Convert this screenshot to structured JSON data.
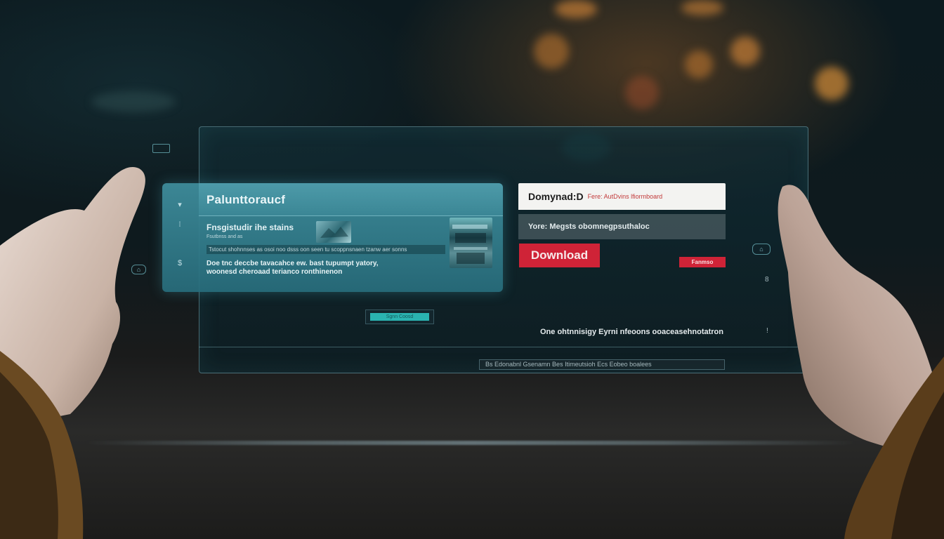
{
  "window": {
    "card_title": "Palunttoraucf",
    "card_subtitle": "Fnsgistudir ihe stains",
    "card_caption": "Fsutbnss and as",
    "card_strip": "Tstocut shohnnses as osoi noo dsss oon seen tu scoppnsnaen tzanw aer sonns",
    "card_description": "Doe tnc deccbe tavacahce ew. bast tupumpt yatory, woonesd cheroaad terianco ronthinenon"
  },
  "rail": {
    "glyph_1": "▾",
    "glyph_2": "⁝",
    "glyph_3": "$"
  },
  "download_panel": {
    "title": "Domynad:D",
    "title_note": "Fere: AutDvins lfiormboard",
    "subtitle": "Yore: Megsts obomnegpsuthaloc",
    "primary_button": "Download",
    "secondary_button": "Fanmso"
  },
  "lower": {
    "center_button": "Sgnn Coosd",
    "footer_text": "One ohtnnisigy Eyrni nfeoons ooaceasehnotatron",
    "status_bar": "Bs Edonabnl Gsenamn Bes Itimeutsioh  Ecs  Eobeo boalees",
    "right_glyph_1": "8",
    "right_glyph_2": "!"
  },
  "outside_widgets": {
    "pill_left": "⌂",
    "pill_right": "⌂"
  },
  "colors": {
    "card_teal": "#3e8c9b",
    "download_red": "#cf2337",
    "panel_white": "#f3f3f1",
    "accent_cyan": "#2ab3b0"
  }
}
